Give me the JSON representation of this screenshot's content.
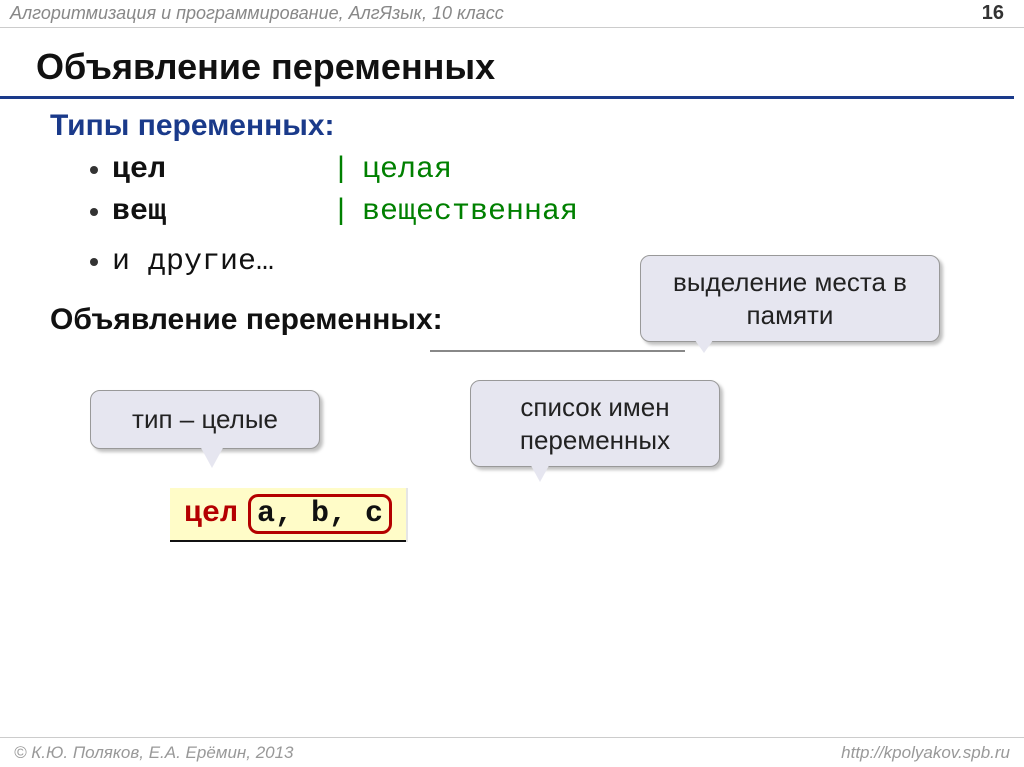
{
  "header": {
    "subject": "Алгоритмизация и программирование, АлгЯзык, 10 класс",
    "page": "16"
  },
  "title": "Объявление  переменных",
  "types_section_title": "Типы переменных:",
  "types": [
    {
      "short": "цел",
      "sep": "|",
      "long": "целая"
    },
    {
      "short": "вещ",
      "sep": "|",
      "long": "вещественная"
    }
  ],
  "types_more": "и другие…",
  "callout_memory": "выделение места в памяти",
  "declaration_section_title": "Объявление переменных:",
  "callout_type": "тип – целые",
  "callout_list": "список имен переменных",
  "code": {
    "keyword": "цел",
    "vars": "a, b, c"
  },
  "footer": {
    "author": "© К.Ю. Поляков, Е.А. Ерёмин, 2013",
    "url": "http://kpolyakov.spb.ru"
  }
}
